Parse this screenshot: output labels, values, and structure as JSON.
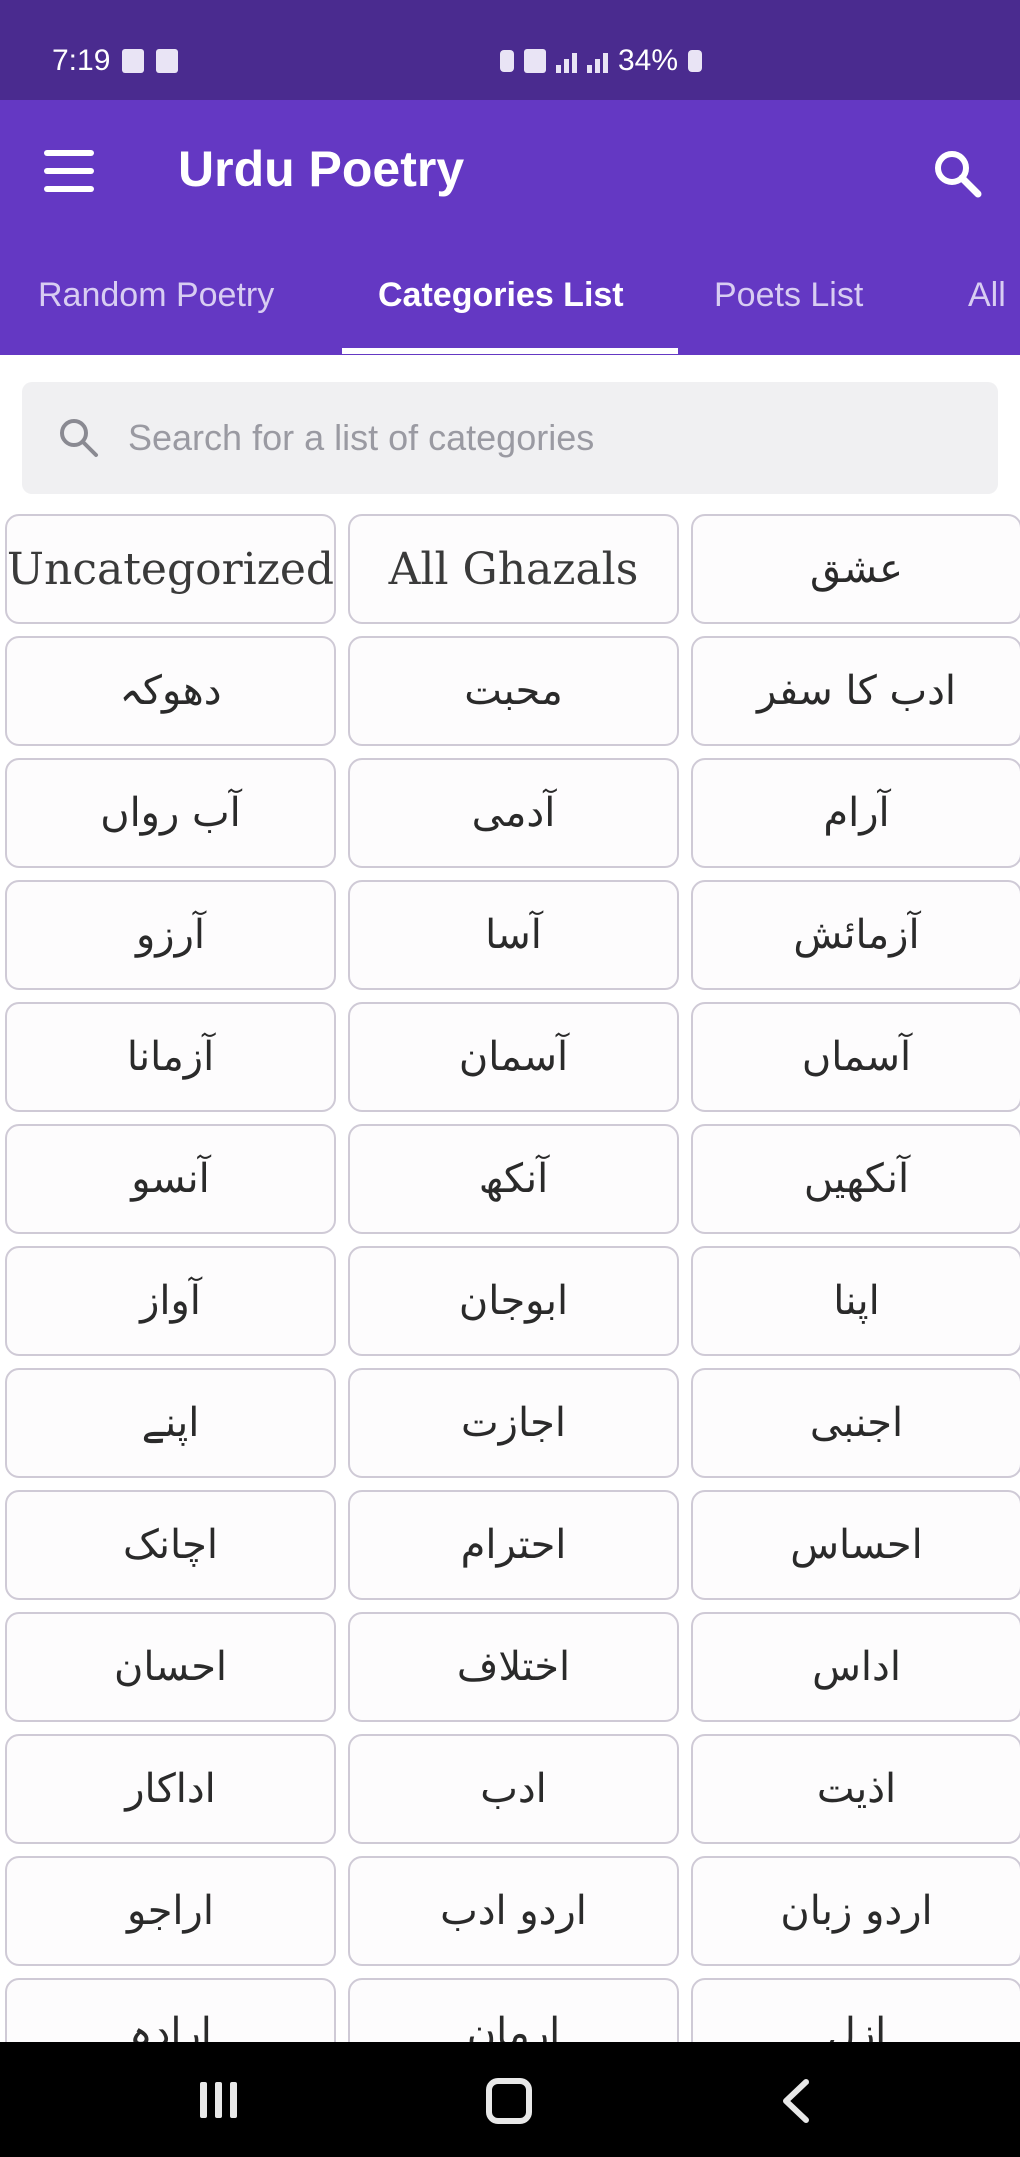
{
  "status_bar": {
    "time": "7:19",
    "battery": "34%"
  },
  "app_bar": {
    "title": "Urdu Poetry",
    "menu_icon": "hamburger-menu-icon",
    "search_icon": "search-icon"
  },
  "tabs": [
    {
      "label": "Random Poetry"
    },
    {
      "label": "Categories List"
    },
    {
      "label": "Poets List"
    },
    {
      "label": "All"
    }
  ],
  "search": {
    "placeholder": "Search for a list of categories"
  },
  "categories": [
    {
      "label": "Uncategorized"
    },
    {
      "label": "All Ghazals"
    },
    {
      "label": "عشق"
    },
    {
      "label": "دھوکہ"
    },
    {
      "label": "محبت"
    },
    {
      "label": "ادب کا سفر"
    },
    {
      "label": "آب رواں"
    },
    {
      "label": "آدمی"
    },
    {
      "label": "آرام"
    },
    {
      "label": "آرزو"
    },
    {
      "label": "آسا"
    },
    {
      "label": "آزمائش"
    },
    {
      "label": "آزمانا"
    },
    {
      "label": "آسمان"
    },
    {
      "label": "آسماں"
    },
    {
      "label": "آنسو"
    },
    {
      "label": "آنکھ"
    },
    {
      "label": "آنکھیں"
    },
    {
      "label": "آواز"
    },
    {
      "label": "ابوجان"
    },
    {
      "label": "اپنا"
    },
    {
      "label": "اپنے"
    },
    {
      "label": "اجازت"
    },
    {
      "label": "اجنبی"
    },
    {
      "label": "اچانک"
    },
    {
      "label": "احترام"
    },
    {
      "label": "احساس"
    },
    {
      "label": "احسان"
    },
    {
      "label": "اختلاف"
    },
    {
      "label": "اداس"
    },
    {
      "label": "اداکار"
    },
    {
      "label": "ادب"
    },
    {
      "label": "اذیت"
    },
    {
      "label": "اراجو"
    },
    {
      "label": "اردو ادب"
    },
    {
      "label": "اردو زبان"
    },
    {
      "label": "ارادہ"
    },
    {
      "label": "ارمان"
    },
    {
      "label": "ازل"
    }
  ],
  "colors": {
    "status_bar": "#4a2b8f",
    "app_bar": "#6438c3",
    "nav_bar": "#000000"
  }
}
